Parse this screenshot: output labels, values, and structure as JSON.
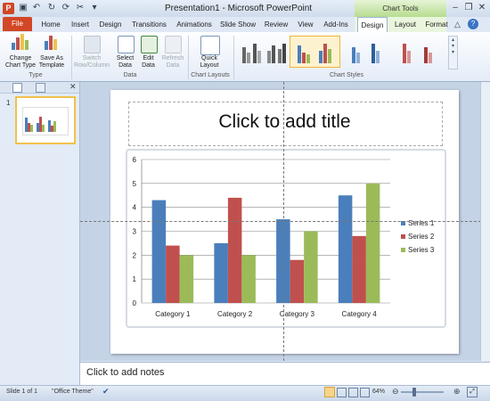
{
  "window": {
    "title": "Presentation1 - Microsoft PowerPoint",
    "context_group": "Chart Tools"
  },
  "tabs": [
    "File",
    "Home",
    "Insert",
    "Design",
    "Transitions",
    "Animations",
    "Slide Show",
    "Review",
    "View",
    "Add-Ins",
    "Design",
    "Layout",
    "Format"
  ],
  "ribbon": {
    "change_chart_type": "Change\nChart Type",
    "save_as_template": "Save As\nTemplate",
    "group_type": "Type",
    "switch_row_column": "Switch\nRow/Column",
    "select_data": "Select\nData",
    "edit_data": "Edit\nData",
    "refresh_data": "Refresh\nData",
    "group_data": "Data",
    "quick_layout": "Quick\nLayout",
    "group_chart_layouts": "Chart Layouts",
    "group_chart_styles": "Chart Styles"
  },
  "slide": {
    "number": "1",
    "title_placeholder": "Click to add title"
  },
  "notes": {
    "placeholder": "Click to add notes"
  },
  "status": {
    "slide_info": "Slide 1 of 1",
    "theme": "\"Office Theme\"",
    "zoom": "64%"
  },
  "chart_data": {
    "type": "bar",
    "categories": [
      "Category 1",
      "Category 2",
      "Category 3",
      "Category 4"
    ],
    "series": [
      {
        "name": "Series 1",
        "values": [
          4.3,
          2.5,
          3.5,
          4.5
        ],
        "color": "#4a7fbc"
      },
      {
        "name": "Series 2",
        "values": [
          2.4,
          4.4,
          1.8,
          2.8
        ],
        "color": "#c0504d"
      },
      {
        "name": "Series 3",
        "values": [
          2.0,
          2.0,
          3.0,
          5.0
        ],
        "color": "#9bbb59"
      }
    ],
    "ylim": [
      0,
      6
    ],
    "yticks": [
      "0",
      "1",
      "2",
      "3",
      "4",
      "5",
      "6"
    ],
    "grid": true,
    "legend": "right"
  }
}
